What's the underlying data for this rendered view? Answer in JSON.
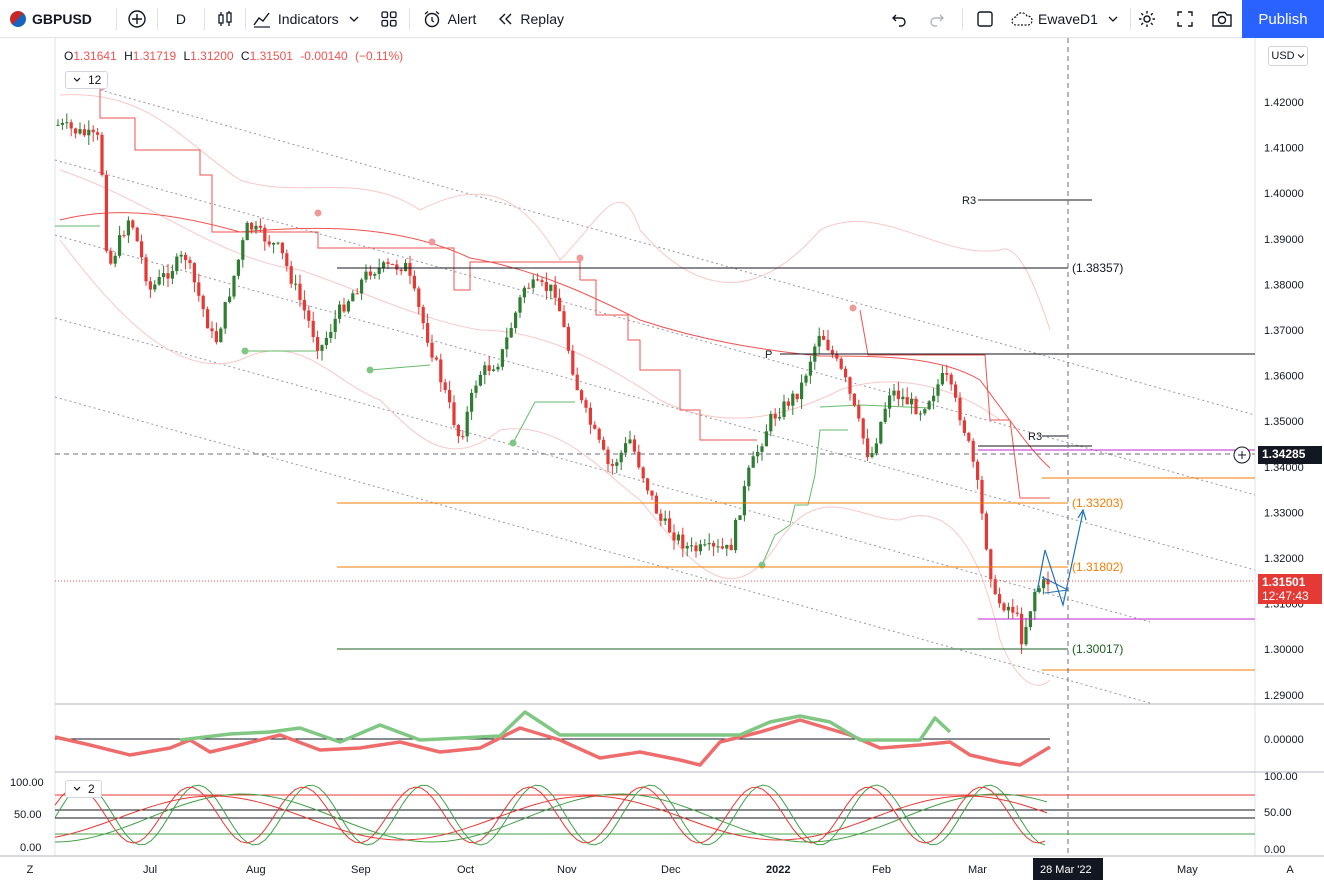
{
  "toolbar": {
    "symbol": "GBPUSD",
    "interval": "D",
    "indicators_label": "Indicators",
    "alert_label": "Alert",
    "replay_label": "Replay",
    "layout_name": "EwaveD1",
    "publish_label": "Publish"
  },
  "legend": {
    "open_label": "O",
    "open": "1.31641",
    "high_label": "H",
    "high": "1.31719",
    "low_label": "L",
    "low": "1.31200",
    "close_label": "C",
    "close": "1.31501",
    "change": "-0.00140",
    "change_pct": "(−0.11%)"
  },
  "badges": {
    "main_indicators": "12",
    "pane3_indicators": "2"
  },
  "currency": "USD",
  "price_axis": {
    "ticks": [
      "1.42000",
      "1.41000",
      "1.40000",
      "1.39000",
      "1.38000",
      "1.37000",
      "1.36000",
      "1.35000",
      "1.34000",
      "1.33000",
      "1.32000",
      "1.31000",
      "1.30000",
      "1.29000"
    ],
    "crosshair_price": "1.34285",
    "last_price": "1.31501",
    "countdown": "12:47:43"
  },
  "osc1_axis": {
    "ticks": [
      "0.00000"
    ]
  },
  "osc2_axis": {
    "ticks_right": [
      "100.00",
      "50.00",
      "0.00"
    ],
    "ticks_left": [
      "100.00",
      "50.00",
      "0.00"
    ]
  },
  "time_axis": {
    "labels": [
      "Jul",
      "Aug",
      "Sep",
      "Oct",
      "Nov",
      "Dec",
      "2022",
      "Feb",
      "Mar",
      "May"
    ],
    "crosshair_date": "28 Mar '22"
  },
  "levels": {
    "r3_upper": "R3",
    "r3_lower": "R3",
    "pivot": "P",
    "l1": "(1.38357)",
    "l2": "(1.33203)",
    "l3": "(1.31802)",
    "l4": "(1.30017)"
  },
  "colors": {
    "up": "#2e7d32",
    "down": "#e53935",
    "accent": "#2962ff",
    "orange": "#f57c00",
    "magenta": "#c026d3"
  },
  "bottom": {
    "left_button": "Z",
    "right_button": "A"
  }
}
